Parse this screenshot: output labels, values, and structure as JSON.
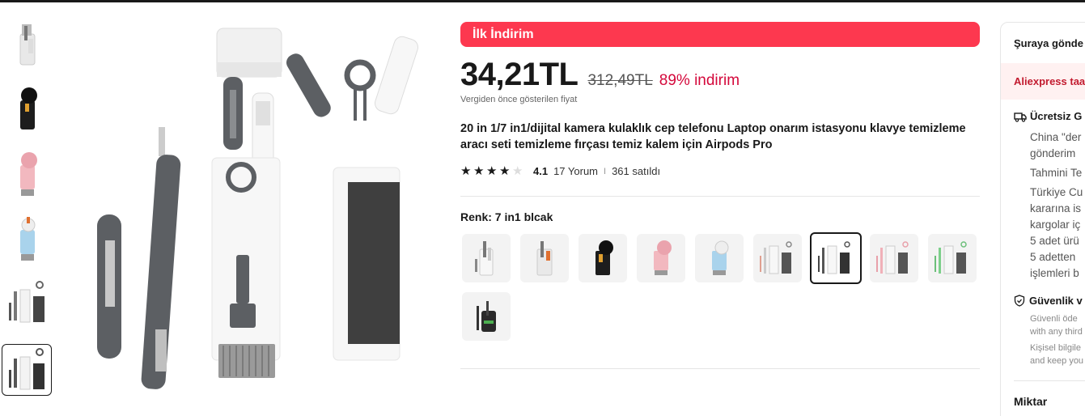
{
  "promo": {
    "label": "İlk İndirim"
  },
  "price": {
    "current": "34,21TL",
    "original": "312,49TL",
    "discount": "89% indirim",
    "note": "Vergiden önce gösterilen fiyat"
  },
  "product": {
    "title": "20 in 1/7 in1/dijital kamera kulaklık cep telefonu Laptop onarım istasyonu klavye temizleme aracı seti temizleme fırçası temiz kalem için Airpods Pro"
  },
  "rating": {
    "value": "4.1",
    "stars": 4,
    "reviews": "17 Yorum",
    "separator": "I",
    "sold": "361 satıldı"
  },
  "color": {
    "label": "Renk: 7 in1 blcak",
    "selected_index": 6,
    "option_count": 10
  },
  "gallery": {
    "thumbnail_count": 6,
    "selected_index": 5
  },
  "side_panel": {
    "ship_to": "Şuraya gönde",
    "aliexpress_band": "Aliexpress taa",
    "free_shipping": "Ücretsiz G",
    "ship_lines": [
      "China \"der",
      "gönderim"
    ],
    "estimate": "Tahmini Te",
    "customs_lines": [
      "Türkiye Cu",
      "kararına is",
      "kargolar iç",
      "5 adet ürü",
      "5 adetten",
      "işlemleri b"
    ],
    "security_title": "Güvenlik v",
    "security_lines": [
      "Güvenli öde",
      "with any third"
    ],
    "privacy_lines": [
      "Kişisel bilgile",
      "and keep you"
    ],
    "quantity_label": "Miktar"
  },
  "colors": {
    "promo_bg": "#fd384f",
    "discount_text": "#d4083b",
    "band_bg": "#fff1f1"
  }
}
